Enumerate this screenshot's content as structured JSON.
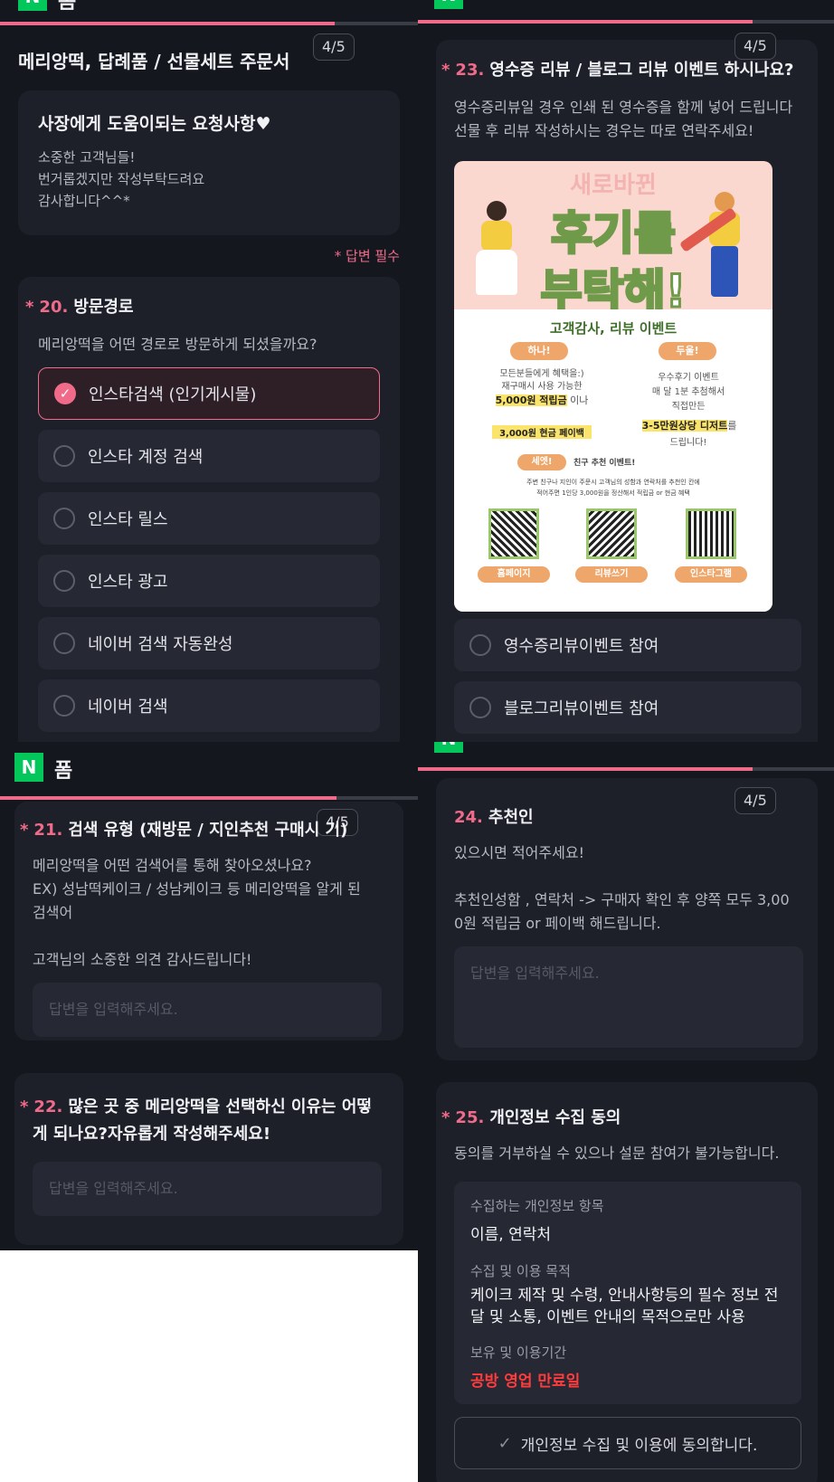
{
  "app": {
    "logo_letter": "N",
    "name": "폼"
  },
  "form": {
    "title": "메리앙떡, 답례품 / 선물세트 주문서",
    "pager": "4/5",
    "required_note": "* 답변 필수"
  },
  "intro": {
    "title": "사장에게 도움이되는 요청사항♥",
    "body": "소중한 고객님들!\n번거롭겠지만 작성부탁드려요\n감사합니다^^*"
  },
  "q20": {
    "star": "*",
    "num": "20.",
    "title": "방문경로",
    "desc": "메리앙떡을 어떤 경로로 방문하게 되셨을까요?",
    "options": [
      "인스타검색 (인기게시물)",
      "인스타 계정 검색",
      "인스타 릴스",
      "인스타 광고",
      "네이버 검색 자동완성",
      "네이버 검색"
    ],
    "selected_mark": "✓"
  },
  "q21": {
    "star": "*",
    "num": "21.",
    "title": "검색 유형 (재방문 / 지인추천 구매시 기)",
    "desc": "메리앙떡을 어떤 검색어를 통해 찾아오셨나요?\nEX) 성남떡케이크 / 성남케이크 등 메리앙떡을 알게 된\n검색어\n\n고객님의 소중한 의견 감사드립니다!",
    "placeholder": "답변을 입력해주세요."
  },
  "q22": {
    "star": "*",
    "num": "22.",
    "title": "많은 곳 중 메리앙떡을 선택하신 이유는 어떻",
    "title2": "게 되나요?자유롭게 작성해주세요!",
    "placeholder": "답변을 입력해주세요."
  },
  "q23": {
    "star": "*",
    "num": "23.",
    "title": "영수증 리뷰 / 블로그 리뷰 이벤트 하시나요?",
    "desc": "영수증리뷰일 경우 인쇄 된 영수증을 함께 넣어 드립니다\n선물 후 리뷰 작성하시는 경우는 따로 연락주세요!",
    "options": [
      "영수증리뷰이벤트 참여",
      "블로그리뷰이벤트 참여"
    ]
  },
  "poster": {
    "top": "새로바뀐",
    "headline1": "후기를",
    "headline2": "부탁해!",
    "subtitle": "고객감사, 리뷰 이벤트",
    "one": "하나!",
    "two": "두울!",
    "one_text1": "모든분들에게 혜택을:)",
    "one_text2": "재구매시 사용 가능한",
    "one_text3": "5,000원 적립금",
    "one_text3b": "이나",
    "one_text4": "3,000원 현금 페이백",
    "two_text1": "우수후기 이벤트",
    "two_text2": "매 달 1분 추첨해서",
    "two_text3": "직접만든",
    "two_text4": "3-5만원상당 디저트",
    "two_text4b": "를",
    "two_text5": "드립니다!",
    "three": "세엣!",
    "three_text": "친구 추천 이벤트!",
    "footer1": "주변 친구나 지인이 주문시 고객님의 성함과 연락처를 추천인 칸에",
    "footer2": "적어주면 1인당 3,000원을 정산해서 적립금 or 현금 혜택",
    "qr_labels": [
      "홈페이지",
      "리뷰쓰기",
      "인스타그램"
    ]
  },
  "q24": {
    "num": "24.",
    "title": "추천인",
    "desc": "있으시면 적어주세요!\n\n추천인성함 , 연락처  -> 구매자 확인 후 양쪽 모두 3,00\n0원 적립금 or 페이백 해드립니다.",
    "placeholder": "답변을 입력해주세요."
  },
  "q25": {
    "star": "*",
    "num": "25.",
    "title": "개인정보 수집 동의",
    "desc": "동의를 거부하실 수 있으나 설문 참여가 불가능합니다.",
    "items_label": "수집하는 개인정보 항목",
    "items_value": "이름, 연락처",
    "purpose_label": "수집 및 이용 목적",
    "purpose_value": "케이크 제작 및 수령, 안내사항등의 필수 정보 전\n달 및 소통, 이벤트 안내의 목적으로만 사용",
    "period_label": "보유 및 이용기간",
    "period_value": "공방 영업 만료일",
    "agree_mark": "✓",
    "agree_label": "개인정보 수집 및 이용에 동의합니다."
  },
  "colors": {
    "accent": "#f06b8a",
    "brand": "#03c75a",
    "bg": "#15171f",
    "card": "#1e2029",
    "warn": "#ff3b3b"
  },
  "progress": {
    "fraction": 0.8
  }
}
